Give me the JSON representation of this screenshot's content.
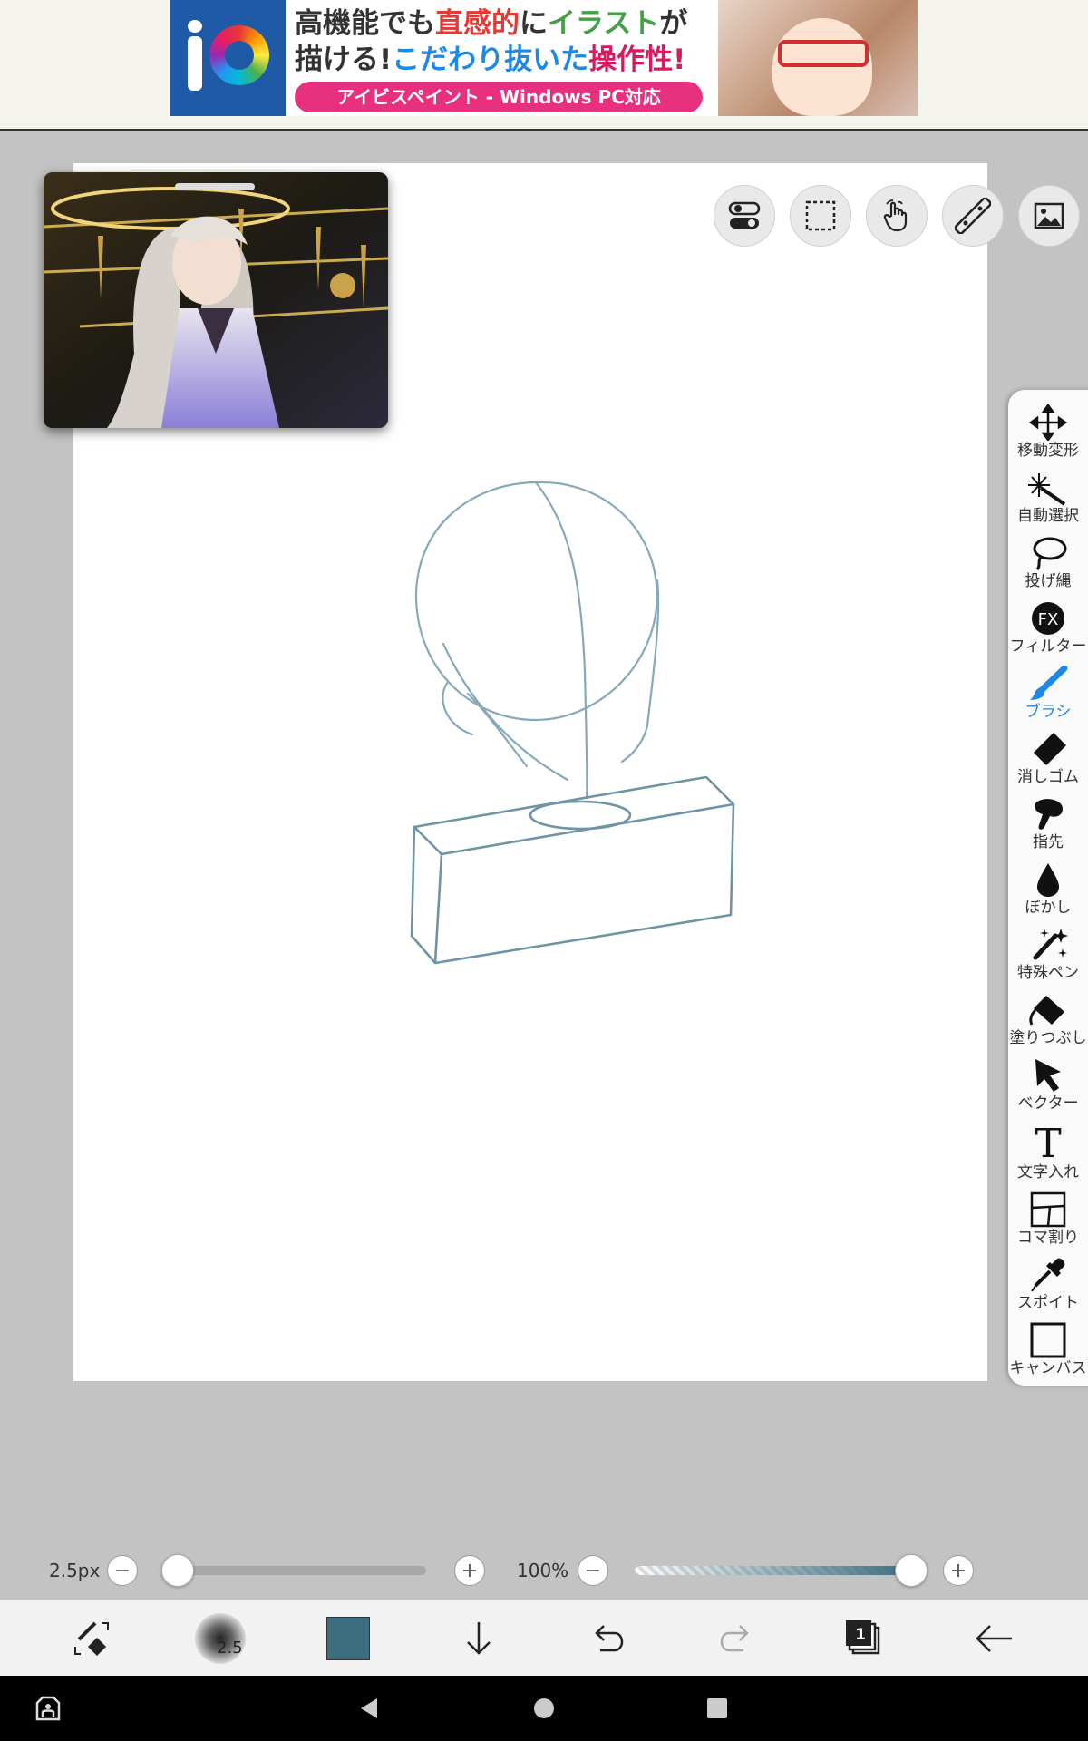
{
  "ad": {
    "line1_a": "高機能でも",
    "line1_b": "直感的",
    "line1_c": "に",
    "line1_d": "イラスト",
    "line1_e": "が",
    "line2_a": "描ける!",
    "line2_b": "こだわり抜いた",
    "line2_c": "操作性!",
    "pill": "アイビスペイント - Windows PC対応"
  },
  "right_toolbar": {
    "items": [
      {
        "label": "移動変形",
        "icon": "move-transform-icon"
      },
      {
        "label": "自動選択",
        "icon": "magic-wand-icon"
      },
      {
        "label": "投げ縄",
        "icon": "lasso-icon"
      },
      {
        "label": "フィルター",
        "icon": "fx-filter-icon"
      },
      {
        "label": "ブラシ",
        "icon": "brush-icon",
        "active": true
      },
      {
        "label": "消しゴム",
        "icon": "eraser-icon"
      },
      {
        "label": "指先",
        "icon": "smudge-finger-icon"
      },
      {
        "label": "ぼかし",
        "icon": "blur-drop-icon"
      },
      {
        "label": "特殊ペン",
        "icon": "special-pen-icon"
      },
      {
        "label": "塗りつぶし",
        "icon": "fill-bucket-icon"
      },
      {
        "label": "ベクター",
        "icon": "vector-arrow-icon"
      },
      {
        "label": "文字入れ",
        "icon": "text-icon"
      },
      {
        "label": "コマ割り",
        "icon": "frame-divider-icon"
      },
      {
        "label": "スポイト",
        "icon": "eyedropper-icon"
      },
      {
        "label": "キャンバス",
        "icon": "canvas-icon"
      }
    ]
  },
  "sliders": {
    "brush_size_label": "2.5px",
    "brush_size_fraction": 0.0,
    "opacity_label": "100%",
    "opacity_fraction": 1.0,
    "minus": "−",
    "plus": "+"
  },
  "bottom_bar": {
    "brush_preview_value": "2.5",
    "layer_count": "1",
    "current_color": "#3d6e80"
  },
  "colors": {
    "accent": "#1e88e5",
    "sketch_stroke": "#86a9b9",
    "box_stroke": "#6f94a4"
  }
}
